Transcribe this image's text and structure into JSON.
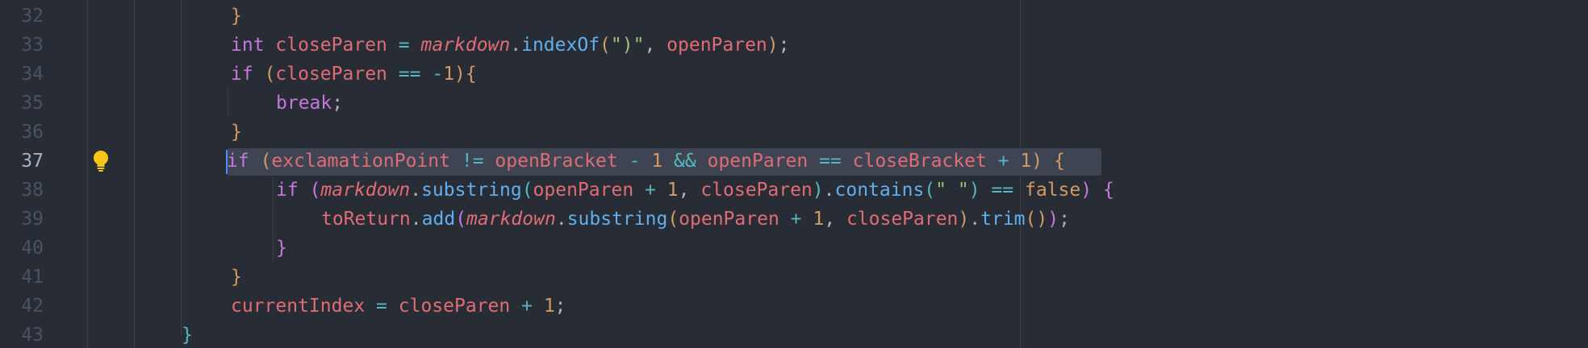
{
  "editor": {
    "active_line": "37",
    "lines": [
      {
        "num": "32",
        "tokens": [
          [
            "}",
            "b1"
          ]
        ]
      },
      {
        "num": "33",
        "tokens": [
          [
            "int",
            "k"
          ],
          [
            " ",
            "p"
          ],
          [
            "closeParen",
            "v"
          ],
          [
            " ",
            "p"
          ],
          [
            "=",
            "o"
          ],
          [
            " ",
            "p"
          ],
          [
            "markdown",
            "i"
          ],
          [
            ".",
            "p"
          ],
          [
            "indexOf",
            "f"
          ],
          [
            "(",
            "b1"
          ],
          [
            "\")\"",
            "s"
          ],
          [
            ", ",
            "p"
          ],
          [
            "openParen",
            "v"
          ],
          [
            ")",
            "b1"
          ],
          [
            ";",
            "p"
          ]
        ]
      },
      {
        "num": "34",
        "tokens": [
          [
            "if",
            "k"
          ],
          [
            " ",
            "p"
          ],
          [
            "(",
            "b1"
          ],
          [
            "closeParen",
            "v"
          ],
          [
            " ",
            "p"
          ],
          [
            "==",
            "o"
          ],
          [
            " ",
            "p"
          ],
          [
            "-",
            "o"
          ],
          [
            "1",
            "n"
          ],
          [
            ")",
            "b1"
          ],
          [
            "{",
            "b1"
          ]
        ]
      },
      {
        "num": "35",
        "tokens": [
          [
            "break",
            "k"
          ],
          [
            ";",
            "p"
          ]
        ]
      },
      {
        "num": "36",
        "tokens": [
          [
            "}",
            "b1"
          ]
        ]
      },
      {
        "num": "37",
        "tokens": [
          [
            "if",
            "k"
          ],
          [
            " ",
            "p"
          ],
          [
            "(",
            "b1"
          ],
          [
            "exclamationPoint",
            "v"
          ],
          [
            " ",
            "p"
          ],
          [
            "!=",
            "o"
          ],
          [
            " ",
            "p"
          ],
          [
            "openBracket",
            "v"
          ],
          [
            " ",
            "p"
          ],
          [
            "-",
            "o"
          ],
          [
            " ",
            "p"
          ],
          [
            "1",
            "n"
          ],
          [
            " ",
            "p"
          ],
          [
            "&&",
            "o"
          ],
          [
            " ",
            "p"
          ],
          [
            "openParen",
            "v"
          ],
          [
            " ",
            "p"
          ],
          [
            "==",
            "o"
          ],
          [
            " ",
            "p"
          ],
          [
            "closeBracket",
            "v"
          ],
          [
            " ",
            "p"
          ],
          [
            "+",
            "o"
          ],
          [
            " ",
            "p"
          ],
          [
            "1",
            "n"
          ],
          [
            ")",
            "b1"
          ],
          [
            " ",
            "p"
          ],
          [
            "{",
            "b1"
          ]
        ]
      },
      {
        "num": "38",
        "tokens": [
          [
            "if",
            "k"
          ],
          [
            " ",
            "p"
          ],
          [
            "(",
            "b2"
          ],
          [
            "markdown",
            "i"
          ],
          [
            ".",
            "p"
          ],
          [
            "substring",
            "f"
          ],
          [
            "(",
            "b3"
          ],
          [
            "openParen",
            "v"
          ],
          [
            " ",
            "p"
          ],
          [
            "+",
            "o"
          ],
          [
            " ",
            "p"
          ],
          [
            "1",
            "n"
          ],
          [
            ", ",
            "p"
          ],
          [
            "closeParen",
            "v"
          ],
          [
            ")",
            "b3"
          ],
          [
            ".",
            "p"
          ],
          [
            "contains",
            "f"
          ],
          [
            "(",
            "b3"
          ],
          [
            "\" \"",
            "s"
          ],
          [
            ")",
            "b3"
          ],
          [
            " ",
            "p"
          ],
          [
            "==",
            "o"
          ],
          [
            " ",
            "p"
          ],
          [
            "false",
            "n"
          ],
          [
            ")",
            "b2"
          ],
          [
            " ",
            "p"
          ],
          [
            "{",
            "b2"
          ]
        ]
      },
      {
        "num": "39",
        "tokens": [
          [
            "toReturn",
            "v"
          ],
          [
            ".",
            "p"
          ],
          [
            "add",
            "f"
          ],
          [
            "(",
            "b2"
          ],
          [
            "markdown",
            "i"
          ],
          [
            ".",
            "p"
          ],
          [
            "substring",
            "f"
          ],
          [
            "(",
            "b1"
          ],
          [
            "openParen",
            "v"
          ],
          [
            " ",
            "p"
          ],
          [
            "+",
            "o"
          ],
          [
            " ",
            "p"
          ],
          [
            "1",
            "n"
          ],
          [
            ", ",
            "p"
          ],
          [
            "closeParen",
            "v"
          ],
          [
            ")",
            "b1"
          ],
          [
            ".",
            "p"
          ],
          [
            "trim",
            "f"
          ],
          [
            "(",
            "b1"
          ],
          [
            ")",
            "b1"
          ],
          [
            ")",
            "b2"
          ],
          [
            ";",
            "p"
          ]
        ]
      },
      {
        "num": "40",
        "tokens": [
          [
            "}",
            "b2"
          ]
        ]
      },
      {
        "num": "41",
        "tokens": [
          [
            "}",
            "b1"
          ]
        ]
      },
      {
        "num": "42",
        "tokens": [
          [
            "currentIndex",
            "v"
          ],
          [
            " ",
            "p"
          ],
          [
            "=",
            "o"
          ],
          [
            " ",
            "p"
          ],
          [
            "closeParen",
            "v"
          ],
          [
            " ",
            "p"
          ],
          [
            "+",
            "o"
          ],
          [
            " ",
            "p"
          ],
          [
            "1",
            "n"
          ],
          [
            ";",
            "p"
          ]
        ]
      },
      {
        "num": "43",
        "tokens": [
          [
            "}",
            "b3"
          ]
        ]
      }
    ]
  },
  "icons": {
    "gutter_hint": "lightbulb-icon"
  },
  "colors": {
    "background": "#282c34",
    "line_highlight": "#3e4451",
    "cursor": "#528bff",
    "lightbulb": "#f5c518"
  }
}
